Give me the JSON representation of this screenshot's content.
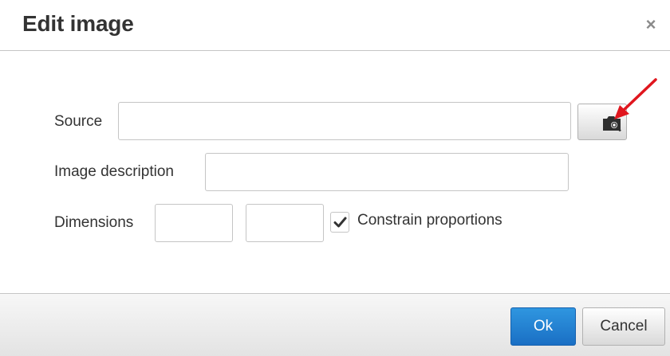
{
  "dialog": {
    "title": "Edit image",
    "close_glyph": "×"
  },
  "form": {
    "source": {
      "label": "Source",
      "value": "",
      "browse_icon": "image-browse-icon"
    },
    "description": {
      "label": "Image description",
      "value": ""
    },
    "dimensions": {
      "label": "Dimensions",
      "width": "",
      "height": ""
    },
    "constrain": {
      "label": "Constrain proportions",
      "checked": true
    }
  },
  "annotation": {
    "color": "#e0161e"
  },
  "buttons": {
    "ok": "Ok",
    "cancel": "Cancel"
  },
  "colors": {
    "ok_accent": "#1a6fc4"
  }
}
